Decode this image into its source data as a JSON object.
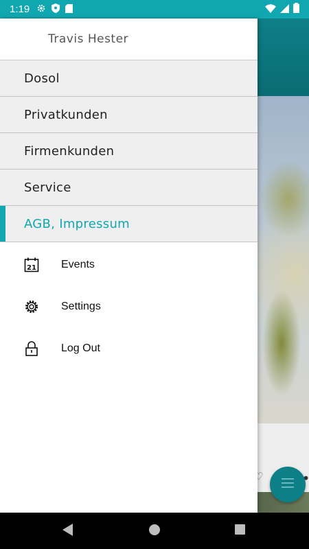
{
  "status_bar": {
    "time": "1:19"
  },
  "drawer": {
    "user_name": "Travis Hester",
    "categories": [
      {
        "label": "Dosol"
      },
      {
        "label": "Privatkunden"
      },
      {
        "label": "Firmenkunden"
      },
      {
        "label": "Service"
      },
      {
        "label": "AGB, Impressum"
      }
    ],
    "active_category": "AGB, Impressum",
    "items": [
      {
        "label": "Events",
        "icon": "calendar-icon",
        "calendar_day": "21"
      },
      {
        "label": "Settings",
        "icon": "gear-icon"
      },
      {
        "label": "Log Out",
        "icon": "lock-icon"
      }
    ]
  },
  "colors": {
    "accent": "#11a7b1",
    "status_bar": "#11a7b1",
    "fab": "#0d7f87"
  }
}
